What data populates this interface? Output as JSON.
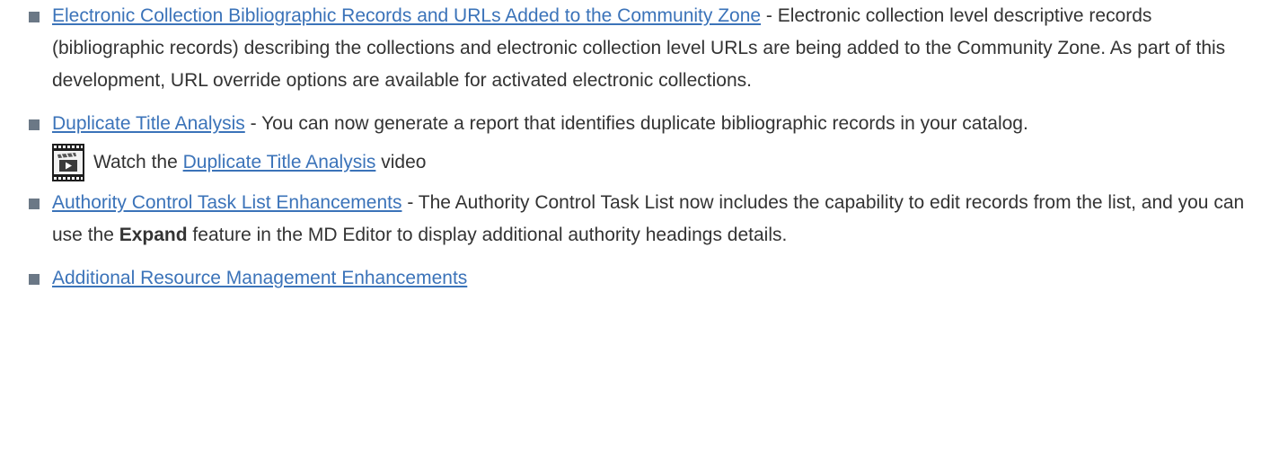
{
  "colors": {
    "link": "#3b73b9",
    "text": "#333333",
    "bullet": "#6b7886"
  },
  "items": [
    {
      "link": "Electronic Collection Bibliographic Records and URLs Added to the Community Zone",
      "text": " - Electronic collection level descriptive records (bibliographic records) describing the collections and electronic collection level URLs are being added to the Community Zone. As part of this development, URL override options are available for activated electronic collections."
    },
    {
      "link": "Duplicate Title Analysis",
      "text": " - You can now generate a report that identifies duplicate bibliographic records in your catalog.",
      "video": {
        "icon": "film-clapper-icon",
        "prefix": "Watch the ",
        "link": "Duplicate Title Analysis",
        "suffix": " video"
      }
    },
    {
      "link": "Authority Control Task List Enhancements",
      "text_before": " - The Authority Control Task List now includes the capability to edit records from the list, and you can use the ",
      "bold": "Expand",
      "text_after": " feature in the MD Editor to display additional authority headings details."
    },
    {
      "link": "Additional Resource Management Enhancements"
    }
  ]
}
